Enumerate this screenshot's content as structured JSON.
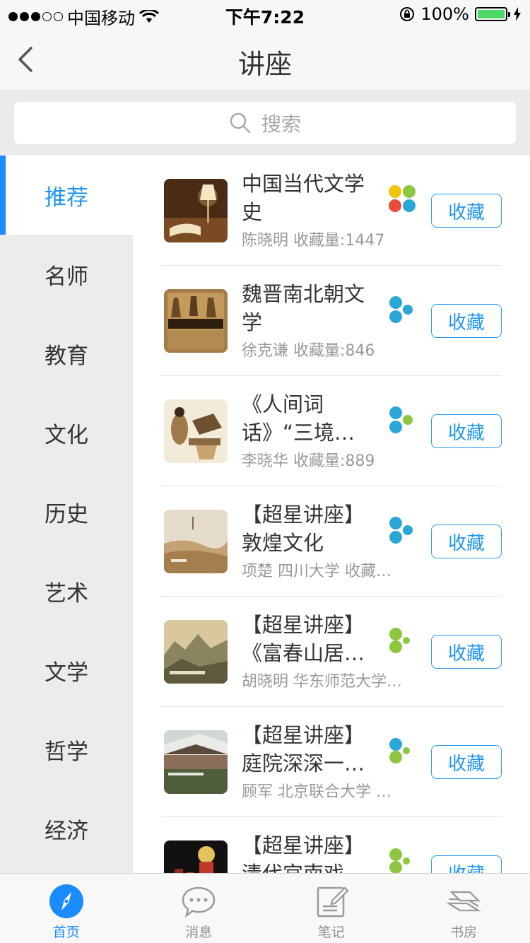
{
  "status_bar": {
    "carrier": "中国移动",
    "time": "下午7:22",
    "battery": "100%",
    "signal_bars": 3,
    "battery_level": 1.0
  },
  "nav": {
    "title": "讲座",
    "back_icon": "chevron-left-icon"
  },
  "search": {
    "placeholder": "搜索",
    "icon": "search-icon"
  },
  "sidebar": {
    "categories": [
      {
        "label": "推荐",
        "active": true
      },
      {
        "label": "名师"
      },
      {
        "label": "教育"
      },
      {
        "label": "文化"
      },
      {
        "label": "历史"
      },
      {
        "label": "艺术"
      },
      {
        "label": "文学"
      },
      {
        "label": "哲学"
      },
      {
        "label": "经济"
      }
    ]
  },
  "lectures": [
    {
      "title": "中国当代文学史",
      "subtitle": "陈晓明  收藏量:1447",
      "fav_label": "收藏",
      "badge": "four-petal-color",
      "thumb_colors": [
        "#3a2412",
        "#8a5a2e",
        "#e8d7b0"
      ]
    },
    {
      "title": "魏晋南北朝文学",
      "subtitle": "徐克谦  收藏量:846",
      "fav_label": "收藏",
      "badge": "three-petal-blue",
      "thumb_colors": [
        "#6b4f2a",
        "#b48a4e",
        "#2a1d10"
      ]
    },
    {
      "title": "《人间词话》“三境…",
      "subtitle": "李晓华  收藏量:889",
      "fav_label": "收藏",
      "badge": "three-petal-blue-green",
      "thumb_colors": [
        "#f0e6d2",
        "#7a5a34",
        "#2d2418"
      ]
    },
    {
      "title": "【超星讲座】敦煌文化",
      "subtitle": "项楚 四川大学  收藏…",
      "fav_label": "收藏",
      "badge": "three-petal-blue",
      "thumb_colors": [
        "#c9b08a",
        "#a07a4a",
        "#e6dccb"
      ]
    },
    {
      "title": "【超星讲座】《富春山居…",
      "subtitle": "胡晓明 华东师范大学…",
      "fav_label": "收藏",
      "badge": "two-petal-green",
      "thumb_colors": [
        "#c8b68c",
        "#6f6a4a",
        "#e8dcb8"
      ]
    },
    {
      "title": "【超星讲座】庭院深深一…",
      "subtitle": "顾军 北京联合大学  …",
      "fav_label": "收藏",
      "badge": "two-petal-blue-green",
      "thumb_colors": [
        "#8fa79a",
        "#4a5a3a",
        "#d8d6c8"
      ]
    },
    {
      "title": "【超星讲座】清代宫南戏…",
      "subtitle": "",
      "fav_label": "收藏",
      "badge": "two-petal-green",
      "thumb_colors": [
        "#1a1a1a",
        "#c0392b",
        "#f1c40f"
      ]
    }
  ],
  "tabbar": {
    "tabs": [
      {
        "label": "首页",
        "icon": "compass-icon",
        "active": true
      },
      {
        "label": "消息",
        "icon": "chat-bubble-icon"
      },
      {
        "label": "笔记",
        "icon": "notepad-icon"
      },
      {
        "label": "书房",
        "icon": "books-icon"
      }
    ]
  },
  "colors": {
    "accent": "#2196f3",
    "sidebar_bg": "#ececec",
    "battery_green": "#4cd964"
  }
}
